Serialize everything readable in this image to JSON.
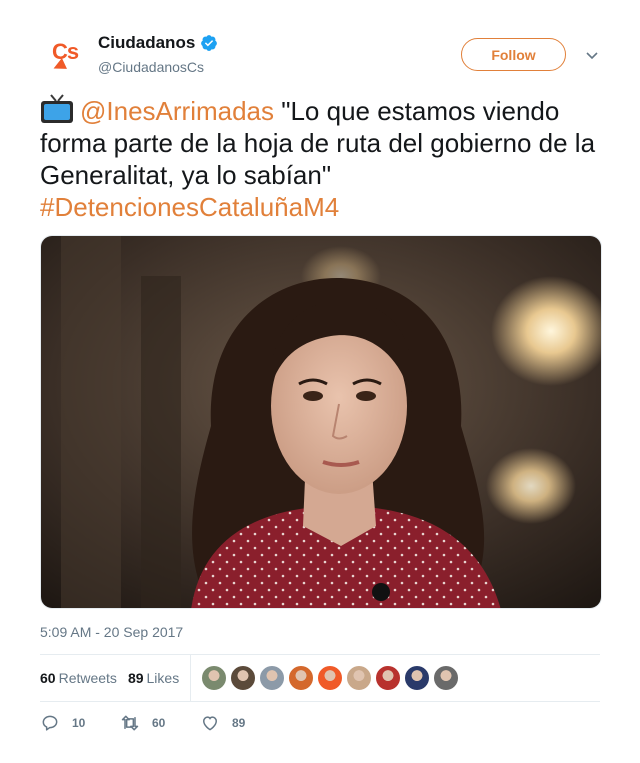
{
  "author": {
    "name": "Ciudadanos",
    "handle": "@CiudadanosCs",
    "avatar_text": "Cs",
    "verified": true
  },
  "follow_label": "Follow",
  "tweet": {
    "mention": "@InesArrimadas",
    "quote": " \"Lo que estamos viendo forma parte de la hoja de ruta del gobierno de la Generalitat, ya lo sabían\"",
    "hashtag": "#DetencionesCataluñaM4",
    "emoji_icon": "tv-icon"
  },
  "timestamp": "5:09 AM - 20 Sep 2017",
  "stats": {
    "retweets_count": "60",
    "retweets_label": "Retweets",
    "likes_count": "89",
    "likes_label": "Likes"
  },
  "liker_colors": [
    "#7a8a6e",
    "#5b4a3a",
    "#8c9aa8",
    "#d4682c",
    "#f05a28",
    "#c9a88a",
    "#b8322e",
    "#2a3a6a",
    "#6a6a6a"
  ],
  "actions": {
    "replies": "10",
    "retweets": "60",
    "likes": "89"
  },
  "colors": {
    "accent": "#e1803a",
    "muted": "#657786",
    "text": "#14171a"
  }
}
